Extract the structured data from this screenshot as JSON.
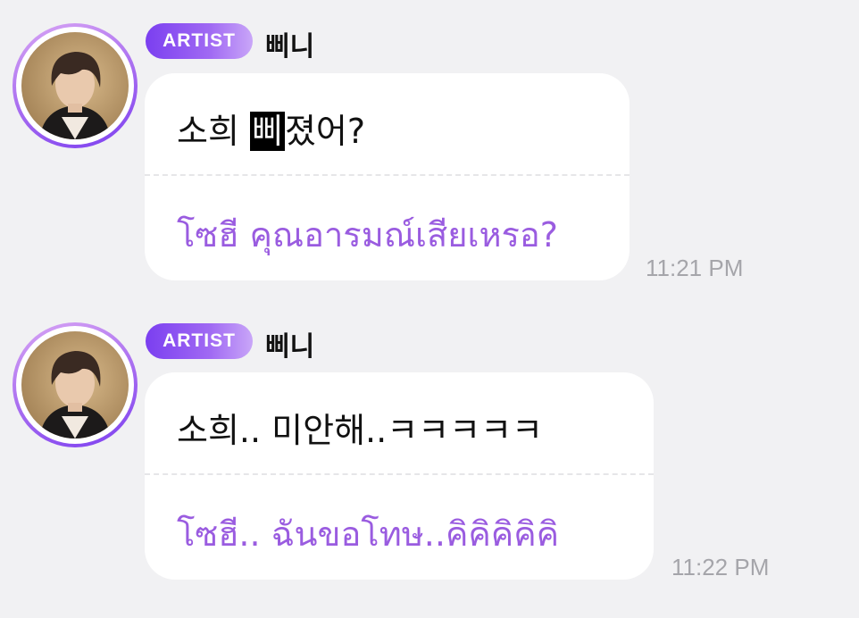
{
  "messages": [
    {
      "badge": "ARTIST",
      "sender": "삐니",
      "text_before": "소희 ",
      "text_highlight": "삐",
      "text_after": "졌어?",
      "translation": "โซฮี คุณอารมณ์เสียเหรอ?",
      "time": "11:21 PM"
    },
    {
      "badge": "ARTIST",
      "sender": "삐니",
      "text_before": "소희.. 미안해..ㅋㅋㅋㅋㅋ",
      "text_highlight": "",
      "text_after": "",
      "translation": "โซฮี.. ฉันขอโทษ..คิคิคิคิคิ",
      "time": "11:22 PM"
    }
  ],
  "colors": {
    "background": "#f1f1f3",
    "badge_start": "#7b3ff0",
    "badge_end": "#c9a6f8",
    "translation_text": "#9a5ce0",
    "timestamp": "#a5a5aa"
  },
  "icons": {
    "avatar": "artist-profile-photo"
  }
}
